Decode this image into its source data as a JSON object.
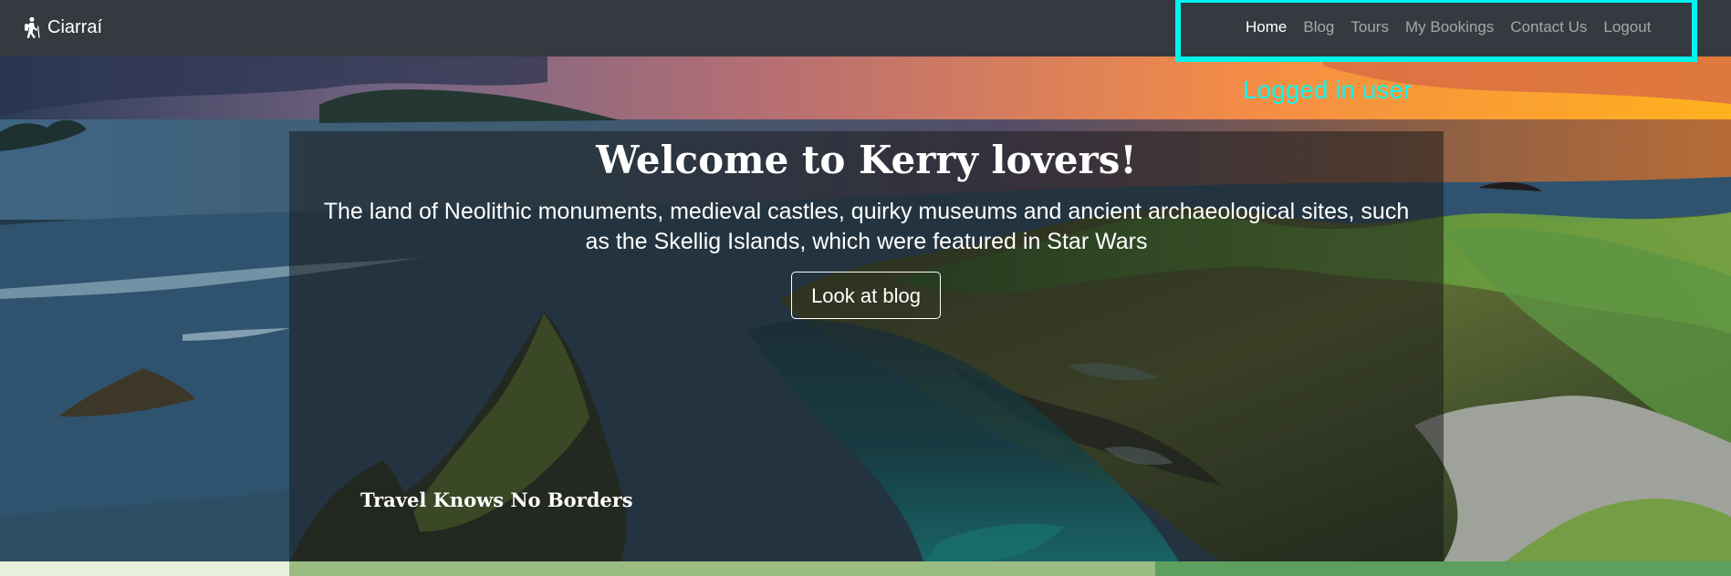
{
  "navbar": {
    "brand": "Ciarraí",
    "brand_icon": "hiking-person-icon",
    "items": [
      {
        "label": "Home",
        "active": true
      },
      {
        "label": "Blog",
        "active": false
      },
      {
        "label": "Tours",
        "active": false
      },
      {
        "label": "My Bookings",
        "active": false
      },
      {
        "label": "Contact Us",
        "active": false
      },
      {
        "label": "Logout",
        "active": false
      }
    ]
  },
  "annotation": {
    "text": "Logged in user",
    "color": "#00f5f0"
  },
  "hero": {
    "title": "Welcome to Kerry lovers!",
    "subtitle": "The land of Neolithic monuments, medieval castles, quirky museums and ancient archaeological sites, such as the Skellig Islands, which were featured in Star Wars",
    "button_label": "Look at blog",
    "tagline": "Travel Knows No Borders"
  },
  "colors": {
    "navbar": "#343a40",
    "active_link": "#ffffff",
    "inactive_link": "rgba(255,255,255,0.55)",
    "overlay": "rgba(24,24,24,0.53)",
    "annotation": "#16f3ec",
    "band_light": "#e9f0dc",
    "band_mid": "#9abc83",
    "band_dark": "#5d9f5e"
  }
}
